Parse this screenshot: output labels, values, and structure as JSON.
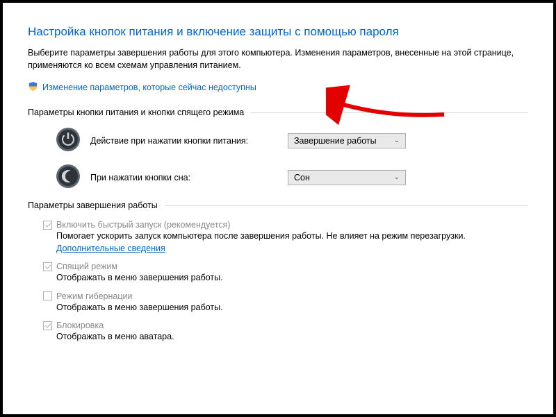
{
  "title": "Настройка кнопок питания и включение защиты с помощью пароля",
  "description": "Выберите параметры завершения работы для этого компьютера. Изменения параметров, внесенные на этой странице, применяются ко всем схемам управления питанием.",
  "changeLink": "Изменение параметров, которые сейчас недоступны",
  "sections": {
    "buttons": {
      "title": "Параметры кнопки питания и кнопки спящего режима",
      "power": {
        "label": "Действие при нажатии кнопки питания:",
        "value": "Завершение работы"
      },
      "sleep": {
        "label": "При нажатии кнопки сна:",
        "value": "Сон"
      }
    },
    "shutdown": {
      "title": "Параметры завершения работы",
      "fastStartup": {
        "label": "Включить быстрый запуск (рекомендуется)",
        "desc": "Помогает ускорить запуск компьютера после завершения работы. Не влияет на режим перезагрузки. ",
        "moreInfo": "Дополнительные сведения"
      },
      "sleep": {
        "label": "Спящий режим",
        "desc": "Отображать в меню завершения работы."
      },
      "hibernate": {
        "label": "Режим гибернации",
        "desc": "Отображать в меню завершения работы."
      },
      "lock": {
        "label": "Блокировка",
        "desc": "Отображать в меню аватара."
      }
    }
  }
}
